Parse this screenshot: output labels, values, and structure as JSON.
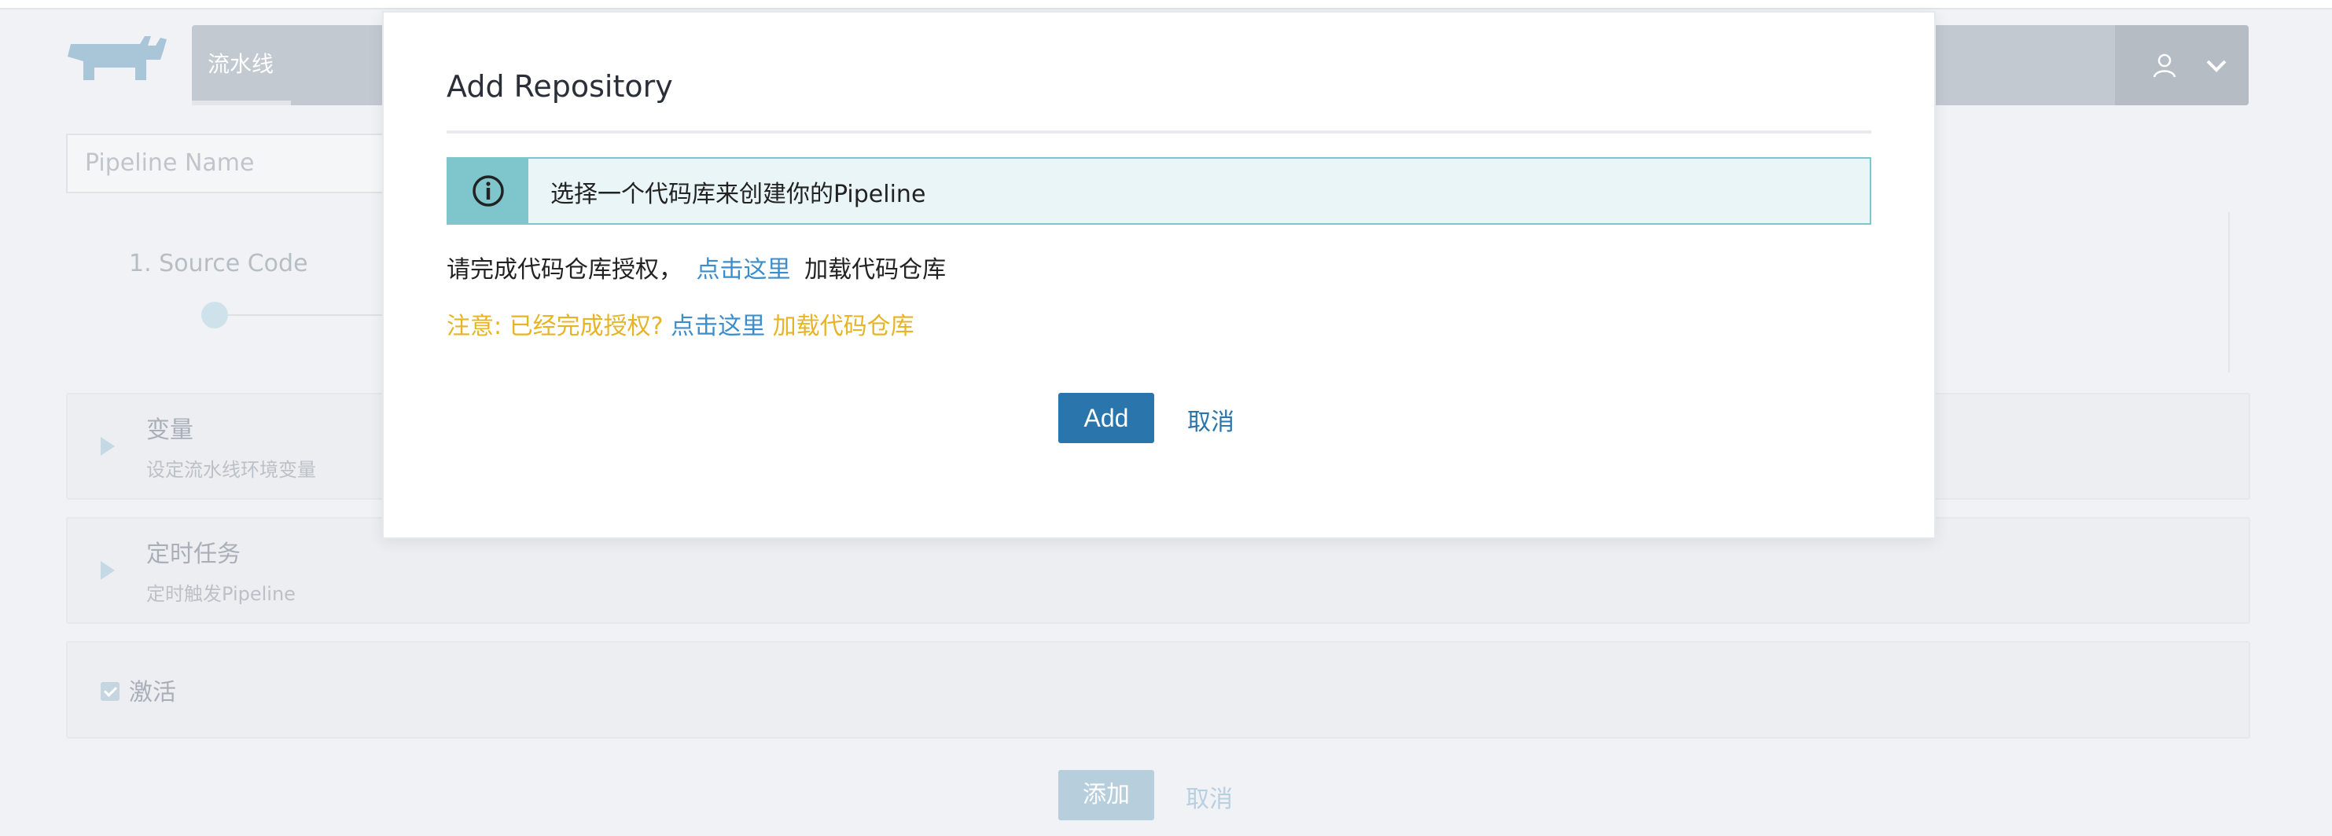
{
  "nav": {
    "active_tab": "流水线",
    "user_icon": "user-icon",
    "menu_icon": "chevron-down-icon"
  },
  "form": {
    "pipeline_name_placeholder": "Pipeline Name",
    "step_1_label": "1. Source Code",
    "variables": {
      "title": "变量",
      "description": "设定流水线环境变量"
    },
    "cron": {
      "title": "定时任务",
      "description": "定时触发Pipeline"
    },
    "active_label": "激活",
    "add_button": "添加",
    "cancel_button": "取消"
  },
  "modal": {
    "title": "Add Repository",
    "info_text": "选择一个代码库来创建你的Pipeline",
    "auth_prefix": "请完成代码仓库授权，",
    "auth_link": "点击这里",
    "auth_suffix": "加载代码仓库",
    "note_prefix": "注意: 已经完成授权?",
    "note_link": "点击这里",
    "note_suffix": "加载代码仓库",
    "add_button": "Add",
    "cancel_button": "取消"
  },
  "colors": {
    "primary": "#2a75ab",
    "link": "#3c8dc9",
    "warning": "#e6b426",
    "info_accent": "#7fc6cc"
  }
}
